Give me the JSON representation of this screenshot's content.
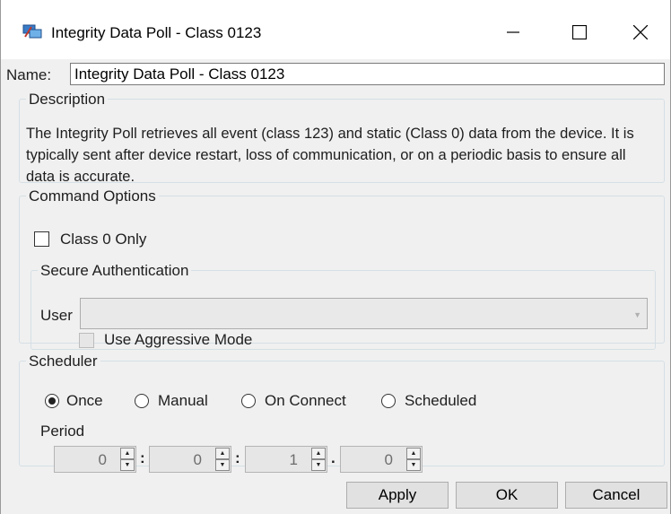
{
  "window": {
    "title": "Integrity Data Poll - Class 0123",
    "icon": "network-icon"
  },
  "name": {
    "label": "Name:",
    "value": "Integrity Data Poll - Class 0123"
  },
  "description": {
    "legend": "Description",
    "text": "The Integrity Poll retrieves all event (class 123) and static (Class 0) data from the device. It is typically sent after device restart, loss of communication, or on a periodic basis to ensure all data is accurate."
  },
  "command_options": {
    "legend": "Command Options",
    "class0_only": {
      "label": "Class 0 Only",
      "checked": false
    },
    "secure_auth": {
      "legend": "Secure Authentication",
      "user_label": "User",
      "user_value": "",
      "aggressive": {
        "label": "Use Aggressive Mode",
        "checked": false,
        "enabled": false
      }
    }
  },
  "scheduler": {
    "legend": "Scheduler",
    "options": [
      {
        "label": "Once",
        "checked": true
      },
      {
        "label": "Manual",
        "checked": false
      },
      {
        "label": "On Connect",
        "checked": false
      },
      {
        "label": "Scheduled",
        "checked": false
      }
    ],
    "period_label": "Period",
    "period": [
      "0",
      "0",
      "1",
      "0"
    ],
    "separators": [
      ":",
      ":",
      "."
    ]
  },
  "buttons": {
    "apply": "Apply",
    "ok": "OK",
    "cancel": "Cancel"
  }
}
